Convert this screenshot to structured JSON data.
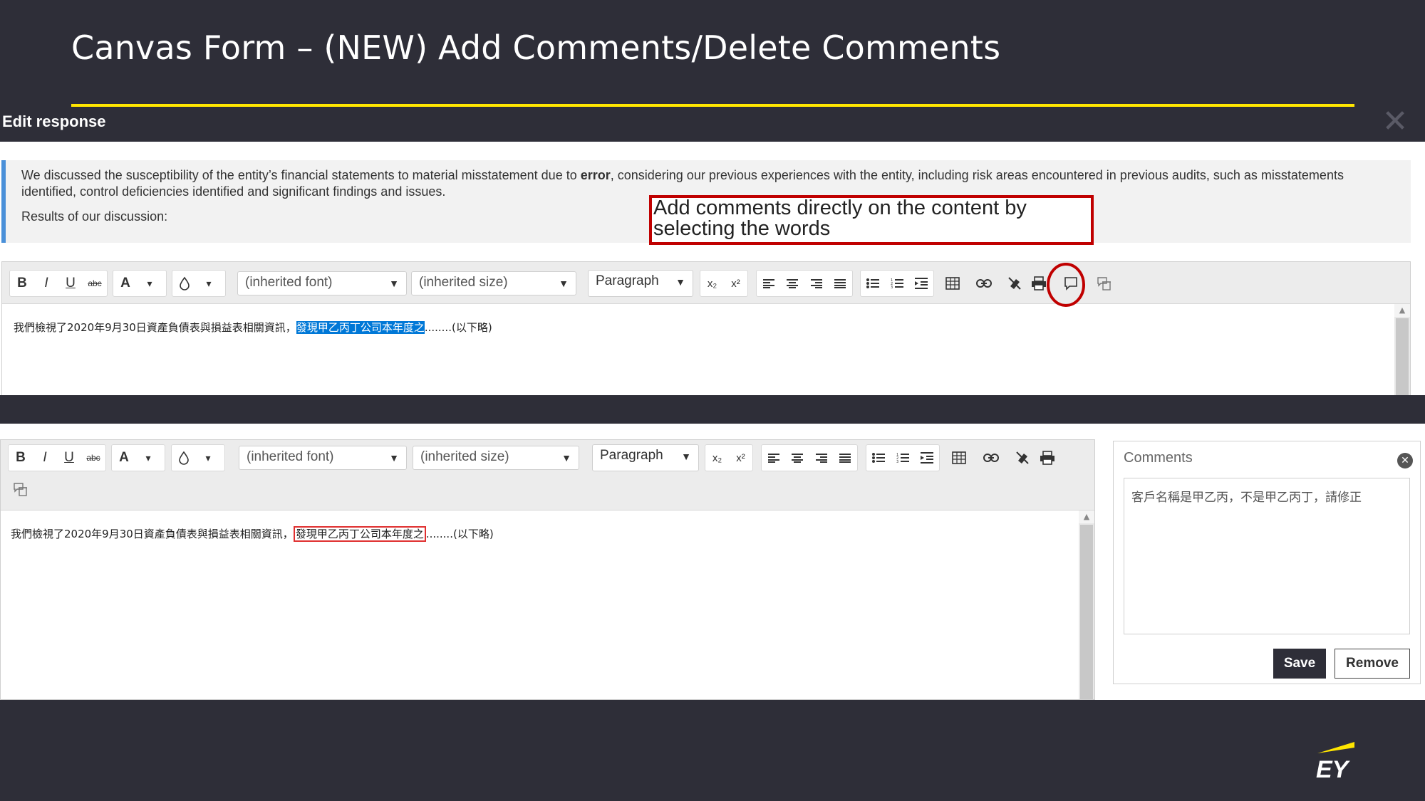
{
  "slide": {
    "title": "Canvas Form – (NEW) Add Comments/Delete Comments",
    "logo_text": "EY"
  },
  "dialog": {
    "title": "Edit response",
    "close_icon": "close-icon"
  },
  "question": {
    "text_before": "We discussed the susceptibility of the entity’s financial statements to material misstatement due to ",
    "text_bold": "error",
    "text_after": ", considering our previous experiences with the entity, including risk areas encountered in previous audits, such as misstatements identified, control deficiencies identified and significant findings and issues.",
    "results_label": "Results of our discussion:"
  },
  "callout": {
    "text": "Add comments directly on the content by selecting the words"
  },
  "toolbar": {
    "bold": "B",
    "italic": "I",
    "underline": "U",
    "strike": "abc",
    "font_color": "A",
    "dropdown_caret": "▾",
    "font_select": "(inherited font)",
    "size_select": "(inherited size)",
    "paragraph_select": "Paragraph",
    "subscript": "x₂",
    "superscript": "x²"
  },
  "editor_top": {
    "text_before": "我們檢視了2020年9月30日資產負債表與損益表相關資訊，",
    "text_selected": "發現甲乙丙丁公司本年度之",
    "text_after": "........(以下略)"
  },
  "editor_bottom": {
    "text_before": "我們檢視了2020年9月30日資產負債表與損益表相關資訊，",
    "text_commented": "發現甲乙丙丁公司本年度之",
    "text_after": "........(以下略)"
  },
  "comments_panel": {
    "title": "Comments",
    "comment_text": "客戶名稱是甲乙丙，不是甲乙丙丁，請修正",
    "save_label": "Save",
    "remove_label": "Remove"
  },
  "colors": {
    "background": "#2e2e38",
    "accent_yellow": "#ffe600",
    "callout_red": "#c00000",
    "selection_blue": "#0078d7",
    "quote_bar_blue": "#4a90d9"
  }
}
